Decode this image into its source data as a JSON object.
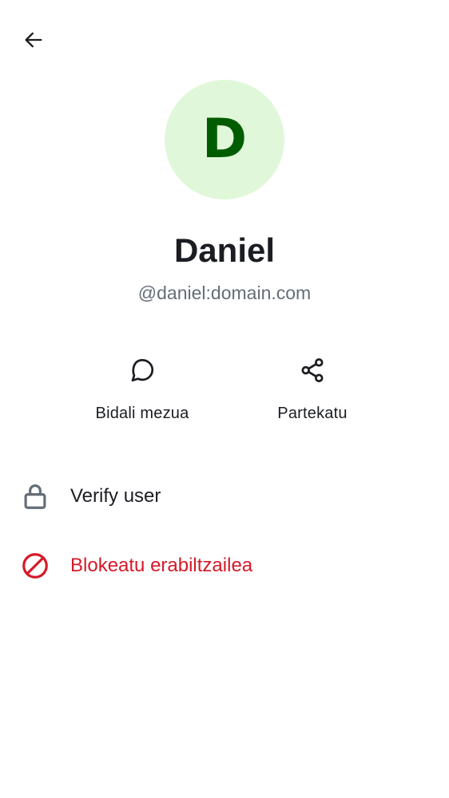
{
  "header": {
    "back_icon": "arrow-left-icon"
  },
  "profile": {
    "avatar_initial": "D",
    "avatar_bg_color": "#e0f8d9",
    "avatar_text_color": "#005c00",
    "display_name": "Daniel",
    "user_id": "@daniel:domain.com"
  },
  "actions": [
    {
      "label": "Bidali mezua",
      "icon": "chat-bubble-icon"
    },
    {
      "label": "Partekatu",
      "icon": "share-icon"
    }
  ],
  "options": {
    "verify": {
      "label": "Verify user",
      "icon": "lock-icon",
      "color": "#1b1d22"
    },
    "block": {
      "label": "Blokeatu erabiltzailea",
      "icon": "block-icon",
      "color": "#d51928"
    }
  }
}
